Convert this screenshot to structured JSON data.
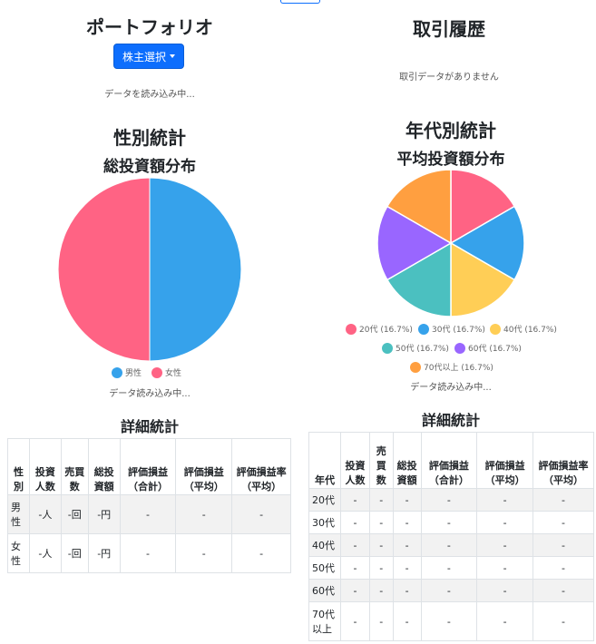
{
  "portfolio": {
    "title": "ポートフォリオ",
    "select_button": "株主選択",
    "loading": "データを読み込み中..."
  },
  "history": {
    "title": "取引履歴",
    "empty": "取引データがありません"
  },
  "gender": {
    "title": "性別統計",
    "chart_title": "総投資額分布",
    "loading": "データ読み込み中...",
    "detail_title": "詳細統計",
    "headers": [
      "性別",
      "投資人数",
      "売買数",
      "総投資額",
      "評価損益（合計）",
      "評価損益（平均）",
      "評価損益率（平均）"
    ],
    "rows": [
      {
        "label": "男性",
        "c1": "-人",
        "c2": "-回",
        "c3": "-円",
        "c4": "-",
        "c5": "-",
        "c6": "-"
      },
      {
        "label": "女性",
        "c1": "-人",
        "c2": "-回",
        "c3": "-円",
        "c4": "-",
        "c5": "-",
        "c6": "-"
      }
    ]
  },
  "age": {
    "title": "年代別統計",
    "chart_title": "平均投資額分布",
    "loading": "データ読み込み中...",
    "detail_title": "詳細統計",
    "headers": [
      "年代",
      "投資人数",
      "売買数",
      "総投資額",
      "評価損益（合計）",
      "評価損益（平均）",
      "評価損益率（平均）"
    ],
    "rows": [
      {
        "label": "20代",
        "c1": "-",
        "c2": "-",
        "c3": "-",
        "c4": "-",
        "c5": "-",
        "c6": "-"
      },
      {
        "label": "30代",
        "c1": "-",
        "c2": "-",
        "c3": "-",
        "c4": "-",
        "c5": "-",
        "c6": "-"
      },
      {
        "label": "40代",
        "c1": "-",
        "c2": "-",
        "c3": "-",
        "c4": "-",
        "c5": "-",
        "c6": "-"
      },
      {
        "label": "50代",
        "c1": "-",
        "c2": "-",
        "c3": "-",
        "c4": "-",
        "c5": "-",
        "c6": "-"
      },
      {
        "label": "60代",
        "c1": "-",
        "c2": "-",
        "c3": "-",
        "c4": "-",
        "c5": "-",
        "c6": "-"
      },
      {
        "label": "70代以上",
        "c1": "-",
        "c2": "-",
        "c3": "-",
        "c4": "-",
        "c5": "-",
        "c6": "-"
      }
    ]
  },
  "colors": {
    "primary": "#0d6efd",
    "pink": "#ff6384",
    "blue": "#36a2eb",
    "yellow": "#ffce56",
    "teal": "#4bc0c0",
    "purple": "#9966ff",
    "orange": "#ff9f40"
  },
  "chart_data": [
    {
      "type": "pie",
      "title": "総投資額分布",
      "categories": [
        "男性",
        "女性"
      ],
      "values": [
        50,
        50
      ],
      "colors": [
        "#36a2eb",
        "#ff6384"
      ],
      "legend": "bottom"
    },
    {
      "type": "pie",
      "title": "平均投資額分布",
      "categories": [
        "20代 (16.7%)",
        "30代 (16.7%)",
        "40代 (16.7%)",
        "50代 (16.7%)",
        "60代 (16.7%)",
        "70代以上 (16.7%)"
      ],
      "values": [
        16.7,
        16.7,
        16.7,
        16.7,
        16.7,
        16.7
      ],
      "colors": [
        "#ff6384",
        "#36a2eb",
        "#ffce56",
        "#4bc0c0",
        "#9966ff",
        "#ff9f40"
      ],
      "legend": "bottom"
    }
  ]
}
